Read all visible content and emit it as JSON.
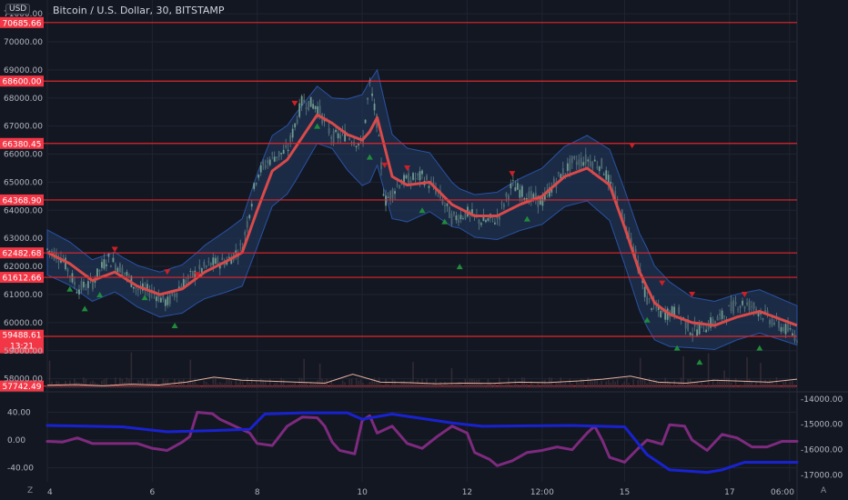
{
  "header": {
    "title": "Bitcoin / U.S. Dollar, 30, BITSTAMP",
    "currency": "USD"
  },
  "footer": {
    "zoom_mode": "Z",
    "auto_mode": "A"
  },
  "colors": {
    "background": "#131722",
    "grid": "#1f2430",
    "level_line": "#e3262b",
    "level_tag": "#f23645",
    "ma": "#d94a4a",
    "band_fill": "#1f3353",
    "band_edge": "#2952a3",
    "candle": "#5b7d80",
    "marker_up": "#1f8c3b",
    "marker_down": "#cc1f26",
    "volume_line": "#e8b0a0",
    "osc_purple": "#7e2a7e",
    "osc_blue": "#1922cf",
    "axis_text": "#b2b5be"
  },
  "chart_data": [
    {
      "type": "candlestick",
      "title": "Bitcoin / U.S. Dollar, 30, BITSTAMP",
      "ylim": [
        57600,
        71100
      ],
      "yticks": [
        58000,
        59000,
        60000,
        61000,
        62000,
        63000,
        64000,
        65000,
        66000,
        67000,
        68000,
        69000,
        70000,
        71000
      ],
      "ytick_labels": [
        "58000.00",
        "59000.00",
        "60000.00",
        "61000.00",
        "62000.00",
        "63000.00",
        "64000.00",
        "65000.00",
        "66000.00",
        "67000.00",
        "68000.00",
        "69000.00",
        "70000.00",
        "71000.00"
      ],
      "x_ticks": [
        {
          "label": "4",
          "pos": 0.0
        },
        {
          "label": "6",
          "pos": 0.14
        },
        {
          "label": "8",
          "pos": 0.28
        },
        {
          "label": "10",
          "pos": 0.42
        },
        {
          "label": "12",
          "pos": 0.56
        },
        {
          "label": "12:00",
          "pos": 0.66
        },
        {
          "label": "15",
          "pos": 0.77
        },
        {
          "label": "17",
          "pos": 0.91
        },
        {
          "label": "06:00",
          "pos": 0.99
        }
      ],
      "levels": [
        {
          "value": 70685.66,
          "label": "70685.66"
        },
        {
          "value": 68600.0,
          "label": "68600.00"
        },
        {
          "value": 66380.45,
          "label": "66380.45"
        },
        {
          "value": 64368.9,
          "label": "64368.90"
        },
        {
          "value": 62482.68,
          "label": "62482.68"
        },
        {
          "value": 61612.66,
          "label": "61612.66"
        },
        {
          "value": 59510.24,
          "label": "59510.24"
        },
        {
          "value": 57742.49,
          "label": "57742.49"
        }
      ],
      "last_price": {
        "value": 59488.61,
        "label": "59488.61",
        "countdown": "13:21"
      },
      "price_path": [
        [
          0.0,
          62600
        ],
        [
          0.02,
          62300
        ],
        [
          0.04,
          61200
        ],
        [
          0.06,
          61400
        ],
        [
          0.08,
          62300
        ],
        [
          0.1,
          61900
        ],
        [
          0.12,
          61200
        ],
        [
          0.14,
          61100
        ],
        [
          0.16,
          60700
        ],
        [
          0.18,
          61400
        ],
        [
          0.2,
          61800
        ],
        [
          0.22,
          62100
        ],
        [
          0.24,
          62200
        ],
        [
          0.26,
          62700
        ],
        [
          0.28,
          65300
        ],
        [
          0.3,
          65900
        ],
        [
          0.32,
          66100
        ],
        [
          0.34,
          67900
        ],
        [
          0.36,
          67700
        ],
        [
          0.38,
          66600
        ],
        [
          0.4,
          66700
        ],
        [
          0.42,
          66300
        ],
        [
          0.43,
          68500
        ],
        [
          0.44,
          67100
        ],
        [
          0.45,
          64300
        ],
        [
          0.47,
          65000
        ],
        [
          0.5,
          65200
        ],
        [
          0.52,
          64700
        ],
        [
          0.54,
          63700
        ],
        [
          0.56,
          63900
        ],
        [
          0.58,
          63600
        ],
        [
          0.6,
          63700
        ],
        [
          0.62,
          64900
        ],
        [
          0.64,
          64500
        ],
        [
          0.66,
          64300
        ],
        [
          0.68,
          65100
        ],
        [
          0.7,
          65700
        ],
        [
          0.72,
          65800
        ],
        [
          0.74,
          65600
        ],
        [
          0.76,
          64300
        ],
        [
          0.78,
          62900
        ],
        [
          0.8,
          60800
        ],
        [
          0.82,
          60300
        ],
        [
          0.84,
          60400
        ],
        [
          0.86,
          59700
        ],
        [
          0.88,
          59900
        ],
        [
          0.9,
          60200
        ],
        [
          0.92,
          60700
        ],
        [
          0.94,
          60600
        ],
        [
          0.96,
          60200
        ],
        [
          1.0,
          59500
        ]
      ],
      "ma_path": [
        [
          0.0,
          62500
        ],
        [
          0.03,
          62100
        ],
        [
          0.06,
          61500
        ],
        [
          0.09,
          61800
        ],
        [
          0.12,
          61300
        ],
        [
          0.15,
          61000
        ],
        [
          0.18,
          61200
        ],
        [
          0.21,
          61800
        ],
        [
          0.24,
          62200
        ],
        [
          0.26,
          62500
        ],
        [
          0.28,
          64000
        ],
        [
          0.3,
          65400
        ],
        [
          0.32,
          65800
        ],
        [
          0.34,
          66600
        ],
        [
          0.36,
          67400
        ],
        [
          0.38,
          67100
        ],
        [
          0.4,
          66700
        ],
        [
          0.42,
          66500
        ],
        [
          0.43,
          66800
        ],
        [
          0.44,
          67300
        ],
        [
          0.46,
          65200
        ],
        [
          0.48,
          64900
        ],
        [
          0.51,
          65000
        ],
        [
          0.54,
          64200
        ],
        [
          0.57,
          63800
        ],
        [
          0.6,
          63800
        ],
        [
          0.63,
          64200
        ],
        [
          0.66,
          64500
        ],
        [
          0.69,
          65200
        ],
        [
          0.72,
          65500
        ],
        [
          0.75,
          64900
        ],
        [
          0.77,
          63400
        ],
        [
          0.79,
          61800
        ],
        [
          0.81,
          60700
        ],
        [
          0.83,
          60300
        ],
        [
          0.86,
          60000
        ],
        [
          0.89,
          59900
        ],
        [
          0.92,
          60200
        ],
        [
          0.95,
          60400
        ],
        [
          1.0,
          59900
        ]
      ],
      "band_width": [
        [
          0.0,
          800
        ],
        [
          0.1,
          700
        ],
        [
          0.2,
          900
        ],
        [
          0.28,
          1300
        ],
        [
          0.33,
          1200
        ],
        [
          0.38,
          900
        ],
        [
          0.43,
          1800
        ],
        [
          0.47,
          1400
        ],
        [
          0.55,
          700
        ],
        [
          0.62,
          900
        ],
        [
          0.7,
          1100
        ],
        [
          0.76,
          1300
        ],
        [
          0.8,
          1400
        ],
        [
          0.86,
          900
        ],
        [
          1.0,
          700
        ]
      ],
      "markers_down": [
        [
          0.09,
          62600
        ],
        [
          0.16,
          61800
        ],
        [
          0.2,
          61700
        ],
        [
          0.33,
          67800
        ],
        [
          0.45,
          65600
        ],
        [
          0.48,
          65500
        ],
        [
          0.62,
          65300
        ],
        [
          0.78,
          66300
        ],
        [
          0.82,
          61400
        ],
        [
          0.86,
          61000
        ],
        [
          0.93,
          61000
        ]
      ],
      "markers_up": [
        [
          0.03,
          61200
        ],
        [
          0.05,
          60500
        ],
        [
          0.07,
          61000
        ],
        [
          0.13,
          60900
        ],
        [
          0.17,
          59900
        ],
        [
          0.36,
          67000
        ],
        [
          0.43,
          65900
        ],
        [
          0.5,
          64000
        ],
        [
          0.53,
          63600
        ],
        [
          0.55,
          62000
        ],
        [
          0.64,
          63700
        ],
        [
          0.8,
          60100
        ],
        [
          0.84,
          59100
        ],
        [
          0.87,
          58600
        ],
        [
          0.95,
          59100
        ]
      ]
    },
    {
      "type": "area",
      "series": [
        {
          "name": "",
          "values": [
            0.15,
            0.18,
            0.12,
            0.2,
            0.16,
            0.3,
            0.55,
            0.4,
            0.35,
            0.3,
            0.25,
            0.7,
            0.3,
            0.28,
            0.22,
            0.25,
            0.24,
            0.3,
            0.28,
            0.35,
            0.45,
            0.6,
            0.3,
            0.25,
            0.4,
            0.35,
            0.3,
            0.45
          ]
        }
      ]
    },
    {
      "type": "line",
      "left_ticks": [
        {
          "value": 40,
          "label": "40.00"
        },
        {
          "value": 0,
          "label": "0.00"
        },
        {
          "value": -40,
          "label": "-40.00"
        }
      ],
      "right_ticks": [
        {
          "value": -14000,
          "label": "-14000.00"
        },
        {
          "value": -15000,
          "label": "-15000.00"
        },
        {
          "value": -16000,
          "label": "-16000.00"
        },
        {
          "value": -17000,
          "label": "-17000.00"
        }
      ],
      "series": [
        {
          "name": "",
          "axis": "left",
          "points": [
            [
              0.0,
              -2
            ],
            [
              0.02,
              -3
            ],
            [
              0.04,
              3
            ],
            [
              0.06,
              -5
            ],
            [
              0.09,
              -5
            ],
            [
              0.12,
              -5
            ],
            [
              0.14,
              -12
            ],
            [
              0.16,
              -15
            ],
            [
              0.18,
              -3
            ],
            [
              0.19,
              5
            ],
            [
              0.2,
              40
            ],
            [
              0.22,
              38
            ],
            [
              0.23,
              30
            ],
            [
              0.25,
              20
            ],
            [
              0.27,
              10
            ],
            [
              0.28,
              -5
            ],
            [
              0.3,
              -8
            ],
            [
              0.32,
              20
            ],
            [
              0.34,
              33
            ],
            [
              0.36,
              32
            ],
            [
              0.37,
              20
            ],
            [
              0.38,
              -3
            ],
            [
              0.39,
              -15
            ],
            [
              0.41,
              -20
            ],
            [
              0.42,
              28
            ],
            [
              0.43,
              35
            ],
            [
              0.44,
              10
            ],
            [
              0.46,
              20
            ],
            [
              0.48,
              -5
            ],
            [
              0.5,
              -12
            ],
            [
              0.52,
              5
            ],
            [
              0.54,
              20
            ],
            [
              0.56,
              10
            ],
            [
              0.57,
              -18
            ],
            [
              0.59,
              -28
            ],
            [
              0.6,
              -37
            ],
            [
              0.62,
              -30
            ],
            [
              0.64,
              -18
            ],
            [
              0.66,
              -15
            ],
            [
              0.68,
              -10
            ],
            [
              0.7,
              -14
            ],
            [
              0.72,
              10
            ],
            [
              0.73,
              20
            ],
            [
              0.74,
              0
            ],
            [
              0.75,
              -25
            ],
            [
              0.77,
              -32
            ],
            [
              0.79,
              -10
            ],
            [
              0.8,
              0
            ],
            [
              0.82,
              -6
            ],
            [
              0.83,
              22
            ],
            [
              0.85,
              20
            ],
            [
              0.86,
              0
            ],
            [
              0.88,
              -15
            ],
            [
              0.9,
              8
            ],
            [
              0.92,
              3
            ],
            [
              0.94,
              -10
            ],
            [
              0.96,
              -10
            ],
            [
              0.98,
              -2
            ],
            [
              1.0,
              -2
            ]
          ]
        },
        {
          "name": "",
          "axis": "right",
          "points": [
            [
              0.0,
              -15050
            ],
            [
              0.1,
              -15100
            ],
            [
              0.16,
              -15300
            ],
            [
              0.22,
              -15250
            ],
            [
              0.27,
              -15200
            ],
            [
              0.29,
              -14600
            ],
            [
              0.34,
              -14550
            ],
            [
              0.4,
              -14550
            ],
            [
              0.42,
              -14800
            ],
            [
              0.46,
              -14600
            ],
            [
              0.54,
              -14950
            ],
            [
              0.58,
              -15080
            ],
            [
              0.7,
              -15050
            ],
            [
              0.77,
              -15100
            ],
            [
              0.8,
              -16200
            ],
            [
              0.83,
              -16800
            ],
            [
              0.88,
              -16900
            ],
            [
              0.9,
              -16800
            ],
            [
              0.93,
              -16500
            ],
            [
              1.0,
              -16500
            ]
          ]
        }
      ]
    }
  ]
}
